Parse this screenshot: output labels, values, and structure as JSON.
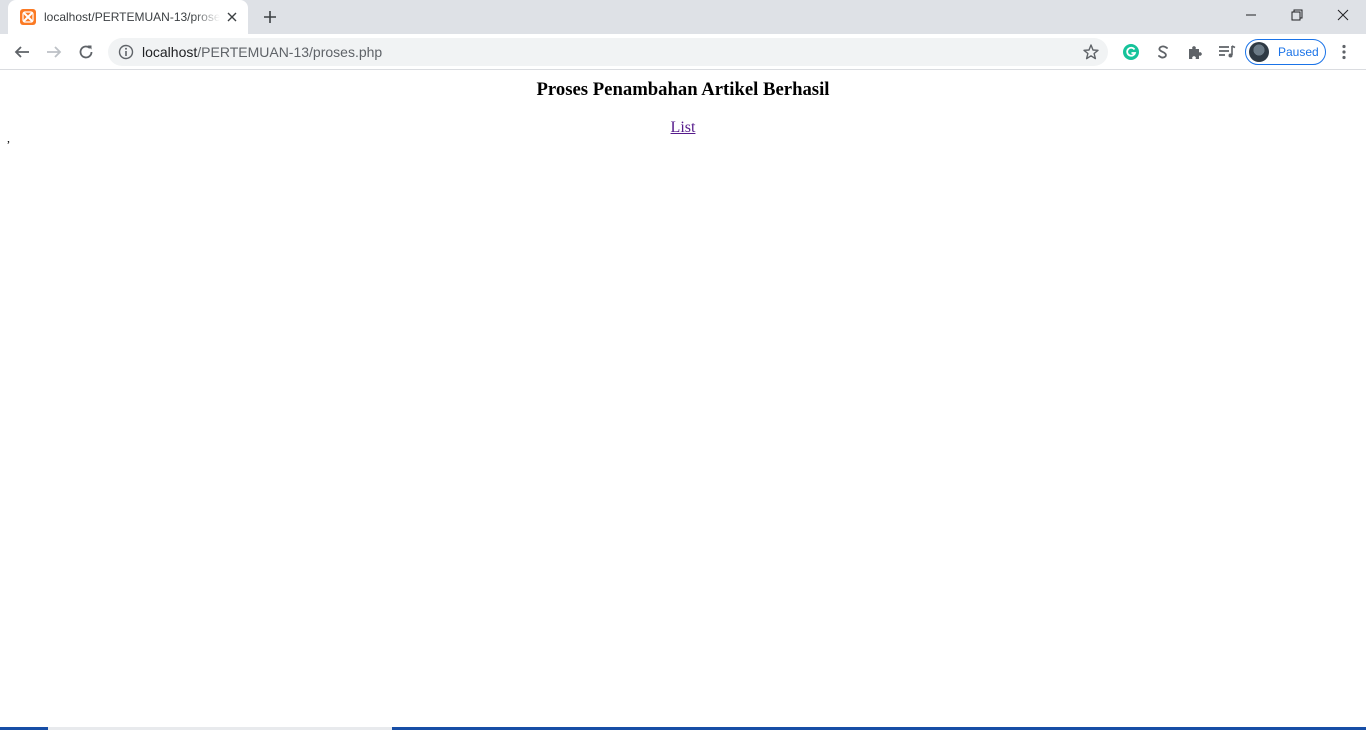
{
  "browser": {
    "tab": {
      "title": "localhost/PERTEMUAN-13/proses.php",
      "favicon": "xampp-icon",
      "favicon_color": "#fb7a24"
    },
    "omnibox": {
      "host": "localhost",
      "path": "/PERTEMUAN-13/proses.php"
    },
    "profile": {
      "label": "Paused"
    },
    "extensions": [
      "grammarly-icon",
      "s-extension-icon",
      "puzzle-icon",
      "media-queue-icon"
    ]
  },
  "page": {
    "heading": "Proses Penambahan Artikel Berhasil",
    "link_label": "List",
    "stray_text": ","
  },
  "colors": {
    "tabstrip_bg": "#dee1e6",
    "accent": "#1a73e8",
    "visited_link": "#551a8b",
    "grammarly": "#15c39a"
  }
}
